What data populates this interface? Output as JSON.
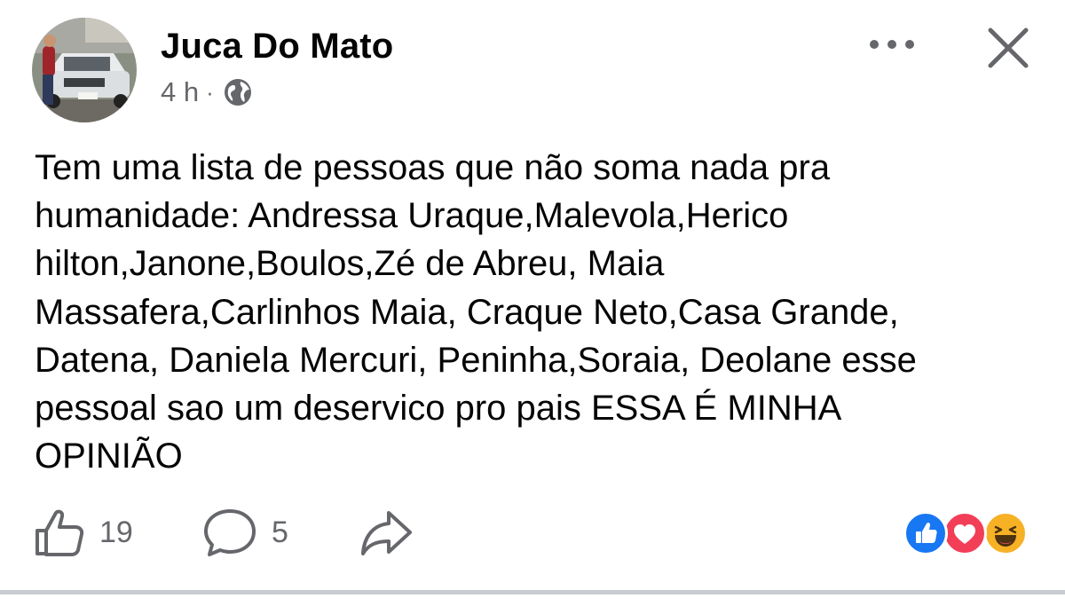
{
  "post": {
    "author": "Juca Do Mato",
    "timestamp": "4 h",
    "separator": "·",
    "privacy_icon": "globe-icon",
    "text": "Tem uma lista de pessoas que não soma nada pra\nhumanidade: Andressa Uraque,Malevola,Herico\nhilton,Janone,Boulos,Zé de Abreu, Maia\nMassafera,Carlinhos Maia, Craque Neto,Casa Grande,\nDatena, Daniela Mercuri, Peninha,Soraia, Deolane esse\npessoal sao um deservico pro pais ESSA É MINHA\nOPINIÃO"
  },
  "header_actions": {
    "more_icon": "more-icon",
    "close_icon": "close-icon"
  },
  "actions": {
    "like_count": "19",
    "comment_count": "5",
    "like_icon": "thumbs-up-icon",
    "comment_icon": "comment-bubble-icon",
    "share_icon": "share-arrow-icon"
  },
  "reactions": [
    "like",
    "love",
    "haha"
  ],
  "colors": {
    "like_blue": "#1877f2",
    "love_red": "#f33e58",
    "haha_yellow": "#f7b125",
    "secondary_text": "#65676b",
    "divider": "#c9ccd1"
  }
}
